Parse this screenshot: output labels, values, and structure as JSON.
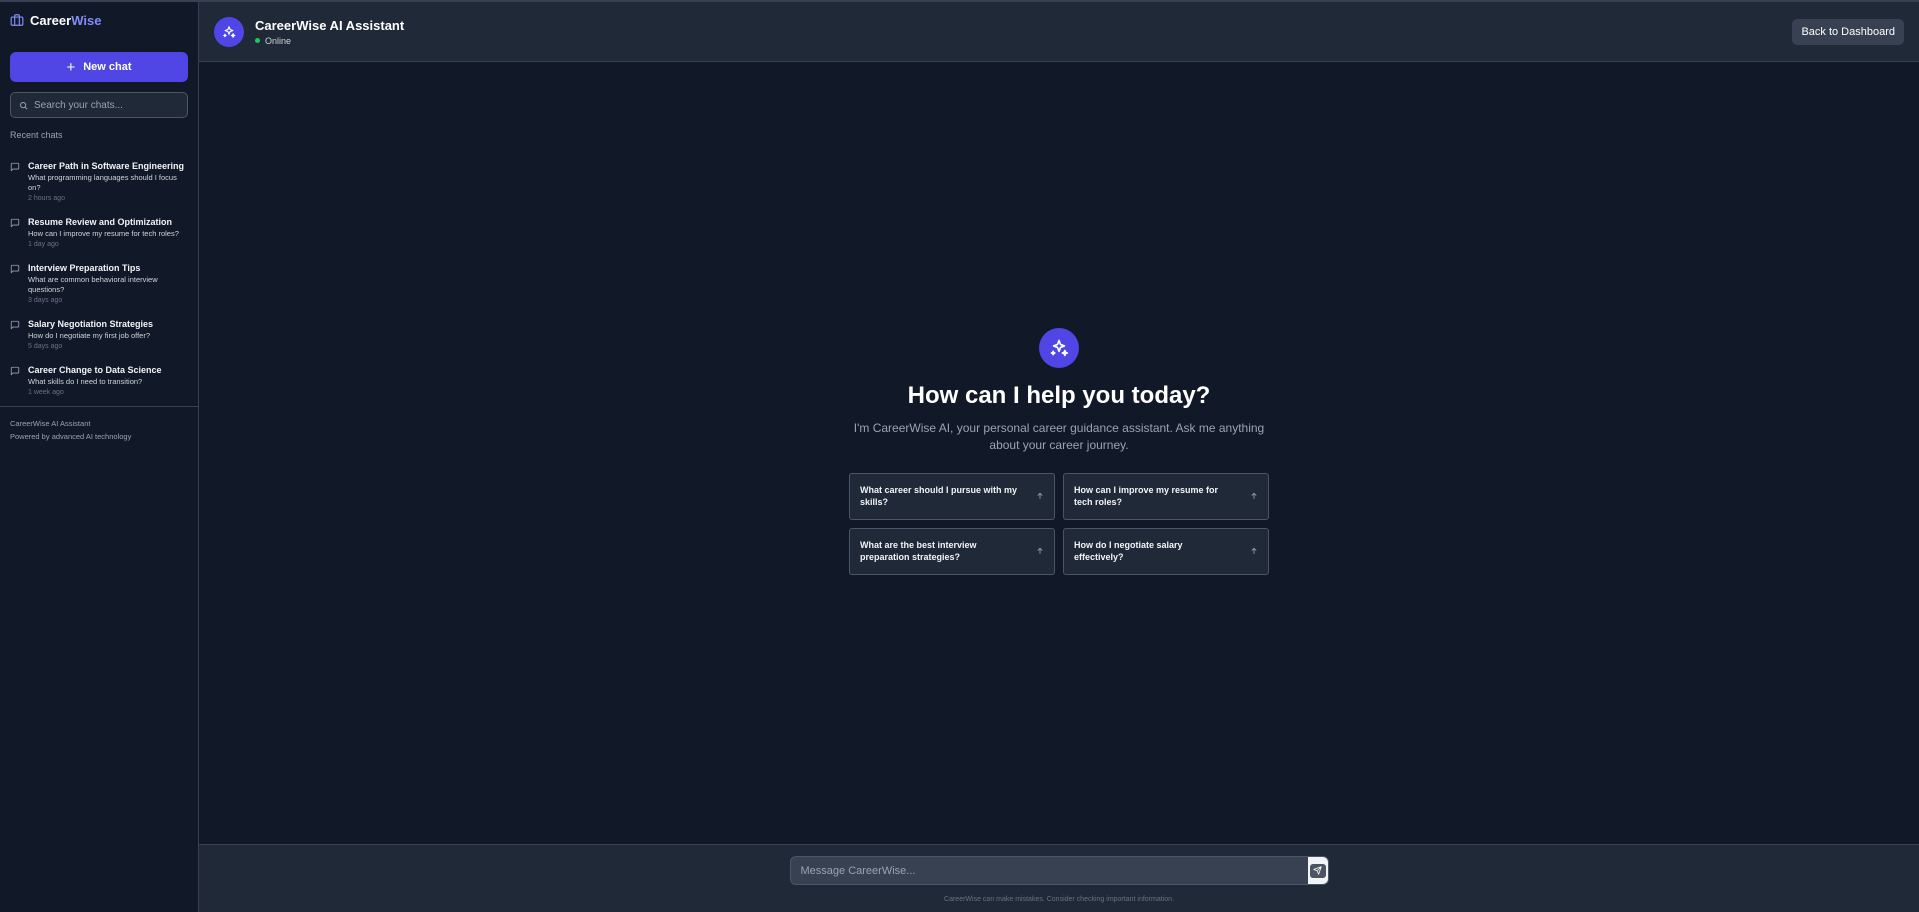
{
  "brand": {
    "name_part1": "Career",
    "name_part2": "Wise"
  },
  "sidebar": {
    "new_chat_label": "New chat",
    "search_placeholder": "Search your chats...",
    "recent_label": "Recent chats",
    "chats": [
      {
        "title": "Career Path in Software Engineering",
        "preview": "What programming languages should I focus on?",
        "time": "2 hours ago"
      },
      {
        "title": "Resume Review and Optimization",
        "preview": "How can I improve my resume for tech roles?",
        "time": "1 day ago"
      },
      {
        "title": "Interview Preparation Tips",
        "preview": "What are common behavioral interview questions?",
        "time": "3 days ago"
      },
      {
        "title": "Salary Negotiation Strategies",
        "preview": "How do I negotiate my first job offer?",
        "time": "5 days ago"
      },
      {
        "title": "Career Change to Data Science",
        "preview": "What skills do I need to transition?",
        "time": "1 week ago"
      }
    ],
    "footer_line1": "CareerWise AI Assistant",
    "footer_line2": "Powered by advanced AI technology"
  },
  "header": {
    "title": "CareerWise AI Assistant",
    "status": "Online",
    "back_label": "Back to Dashboard"
  },
  "hero": {
    "title": "How can I help you today?",
    "subtitle": "I'm CareerWise AI, your personal career guidance assistant. Ask me anything about your career journey."
  },
  "suggestions": [
    "What career should I pursue with my skills?",
    "How can I improve my resume for tech roles?",
    "What are the best interview preparation strategies?",
    "How do I negotiate salary effectively?"
  ],
  "composer": {
    "placeholder": "Message CareerWise...",
    "disclaimer": "CareerWise can make mistakes. Consider checking important information."
  },
  "colors": {
    "accent": "#4f46e5",
    "background": "#111827",
    "panel": "#1f2937",
    "online": "#22c55e"
  },
  "icons": {
    "brand": "briefcase-icon",
    "new_chat": "plus-icon",
    "search": "search-icon",
    "chat": "message-icon",
    "assistant": "sparkles-icon",
    "suggestion": "arrow-up-icon",
    "send": "send-icon"
  }
}
